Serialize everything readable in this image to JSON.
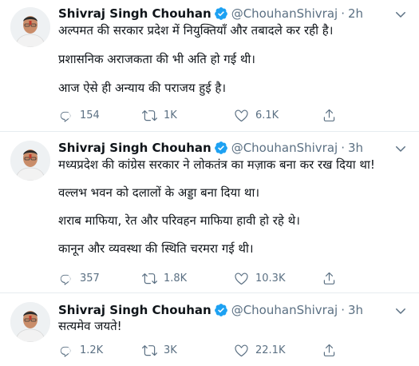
{
  "tweets": [
    {
      "name": "Shivraj Singh Chouhan",
      "handle": "@ChouhanShivraj",
      "separator": "·",
      "time": "2h",
      "paragraphs": [
        "अल्पमत की सरकार प्रदेश में नियुक्तियाँ और तबादले कर रही है।",
        "प्रशासनिक अराजकता की भी अति हो गई थी।",
        "आज ऐसे ही अन्याय की पराजय हुई है।"
      ],
      "replies": "154",
      "retweets": "1K",
      "likes": "6.1K"
    },
    {
      "name": "Shivraj Singh Chouhan",
      "handle": "@ChouhanShivraj",
      "separator": "·",
      "time": "3h",
      "paragraphs": [
        "मध्यप्रदेश की कांग्रेस सरकार ने लोकतंत्र का मज़ाक बना कर रख दिया था!",
        "वल्लभ भवन को दलालों के अड्डा बना दिया था।",
        "शराब माफिया, रेत और परिवहन माफिया हावी हो रहे थे।",
        "कानून और व्यवस्था की स्थिति चरमरा गई थी।"
      ],
      "replies": "357",
      "retweets": "1.8K",
      "likes": "10.3K"
    },
    {
      "name": "Shivraj Singh Chouhan",
      "handle": "@ChouhanShivraj",
      "separator": "·",
      "time": "3h",
      "paragraphs": [
        "सत्यमेव जयते!"
      ],
      "replies": "1.2K",
      "retweets": "3K",
      "likes": "22.1K"
    }
  ],
  "colors": {
    "verified": "#1da1f2",
    "muted": "#5b7083",
    "border": "#e6ecf0",
    "text": "#0f1419"
  },
  "icons": {
    "verified": "verified-badge-icon",
    "more": "chevron-down-icon",
    "reply": "reply-icon",
    "retweet": "retweet-icon",
    "like": "heart-icon",
    "share": "share-icon"
  }
}
